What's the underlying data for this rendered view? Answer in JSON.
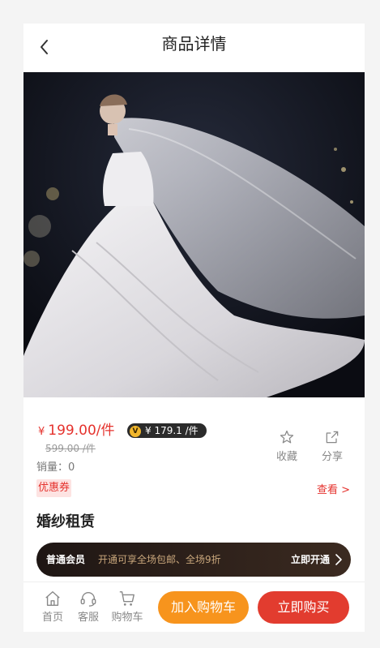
{
  "header": {
    "title": "商品详情"
  },
  "product": {
    "currency": "¥",
    "price": "199.00/件",
    "vip_badge": "V",
    "vip_price": "¥ 179.1 /件",
    "original_price": "599.00 /件",
    "sales": "销量：0",
    "name": "婚纱租赁"
  },
  "actions": {
    "favorite": "收藏",
    "share": "分享"
  },
  "coupon": {
    "tag": "优惠券",
    "link": "查看 >"
  },
  "membership": {
    "level": "普通会员",
    "desc": "开通可享全场包邮、全场9折",
    "button": "立即开通"
  },
  "tabbar": {
    "home": "首页",
    "service": "客服",
    "cart": "购物车",
    "add_to_cart": "加入购物车",
    "buy_now": "立即购买"
  },
  "colors": {
    "price": "#e5322d",
    "cart_button": "#f7941d",
    "buy_button": "#e23c2f",
    "member_bg": "#1e1614"
  },
  "icons": [
    "back-arrow-icon",
    "star-icon",
    "share-icon",
    "home-icon",
    "headset-icon",
    "cart-icon",
    "chevron-right-icon"
  ]
}
